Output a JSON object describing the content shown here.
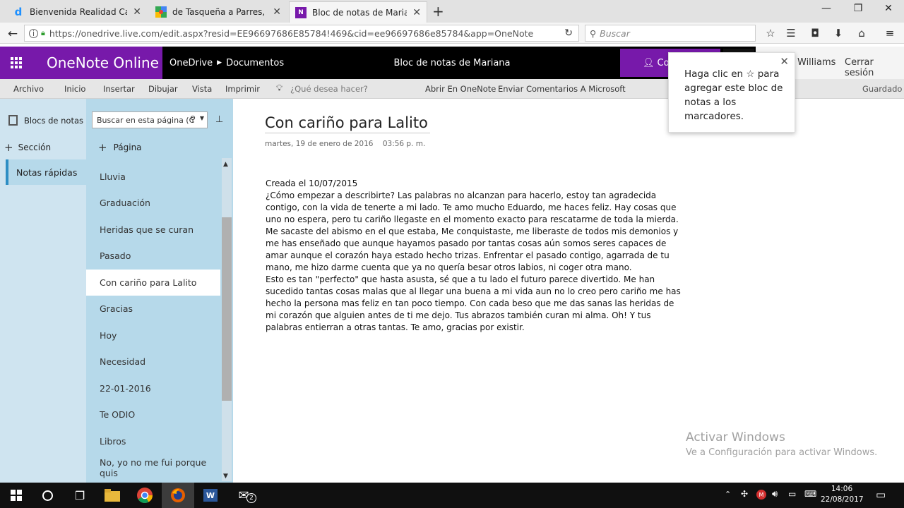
{
  "browser": {
    "tabs": [
      {
        "title": "Bienvenida Realidad Capitulo",
        "icon": "d-logo-icon",
        "active": false
      },
      {
        "title": "de Tasqueña a Parres, CDMX",
        "icon": "google-maps-icon",
        "active": false
      },
      {
        "title": "Bloc de notas de Mariana - N",
        "icon": "onenote-icon",
        "active": true
      }
    ],
    "url": "https://onedrive.live.com/edit.aspx?resid=EE96697686E85784!469&cid=ee96697686e85784&app=OneNote",
    "search_placeholder": "Buscar"
  },
  "app": {
    "name": "OneNote Online",
    "breadcrumb_root": "OneDrive",
    "breadcrumb_folder": "Documentos",
    "notebook_title": "Bloc de notas de Mariana",
    "share_label": "Co",
    "user_name": "Williams",
    "signout_label": "Cerrar sesión",
    "accent": "#7719aa"
  },
  "ribbon": {
    "tabs": [
      "Archivo",
      "Inicio",
      "Insertar",
      "Dibujar",
      "Vista",
      "Imprimir"
    ],
    "tell_me": "¿Qué desea hacer?",
    "open_desktop": "Abrir En OneNote",
    "feedback": "Enviar Comentarios A Microsoft",
    "status": "Guardado"
  },
  "sidebar": {
    "notebooks_label": "Blocs de notas",
    "add_section_label": "Sección",
    "sections": [
      "Notas rápidas"
    ],
    "search_placeholder": "Buscar en esta página (C",
    "add_page_label": "Página",
    "pages": [
      "Lluvia",
      "Graduación",
      "Heridas que se curan",
      "Pasado",
      "Con cariño para Lalito",
      "Gracias",
      "Hoy",
      "Necesidad",
      "22-01-2016",
      "Te ODIO",
      "Libros",
      "No, yo no me fui porque quis"
    ],
    "selected_page": "Con cariño para Lalito"
  },
  "note": {
    "title": "Con cariño para Lalito",
    "date": "martes, 19 de enero de 2016",
    "time": "03:56 p. m.",
    "paragraphs": [
      "Creada el 10/07/2015",
      "¿Cómo empezar a describirte? Las palabras no alcanzan para hacerlo, estoy tan agradecida contigo, con la vida de tenerte a mi lado. Te amo mucho Eduardo, me haces feliz. Hay cosas que uno no espera, pero tu cariño llegaste en el momento exacto para rescatarme de toda la mierda. Me sacaste del abismo en el que estaba, Me conquistaste, me liberaste de todos mis demonios y me has enseñado que aunque hayamos pasado por tantas cosas aún somos seres capaces de amar aunque el corazón haya estado hecho trizas. Enfrentar el pasado contigo, agarrada de tu mano, me hizo darme cuenta que ya no quería besar otros labios, ni coger otra mano.",
      "Esto es tan \"perfecto\" que hasta asusta, sé que a tu lado el futuro parece divertido. Me han sucedido tantas cosas malas que al llegar una buena a mi vida aun no lo creo pero cariño me has hecho la persona mas feliz en tan poco tiempo. Con cada beso que me das sanas las heridas de mi corazón que alguien antes de ti me dejo. Tus abrazos también curan mi alma. Oh! Y tus palabras entierran a otras tantas. Te amo, gracias por existir."
    ]
  },
  "callout": {
    "text": "Haga clic en ☆ para agregar este bloc de notas a los marcadores."
  },
  "watermark": {
    "line1": "Activar Windows",
    "line2": "Ve a Configuración para activar Windows."
  },
  "taskbar": {
    "time": "14:06",
    "date": "22/08/2017",
    "mail_badge": "2"
  }
}
